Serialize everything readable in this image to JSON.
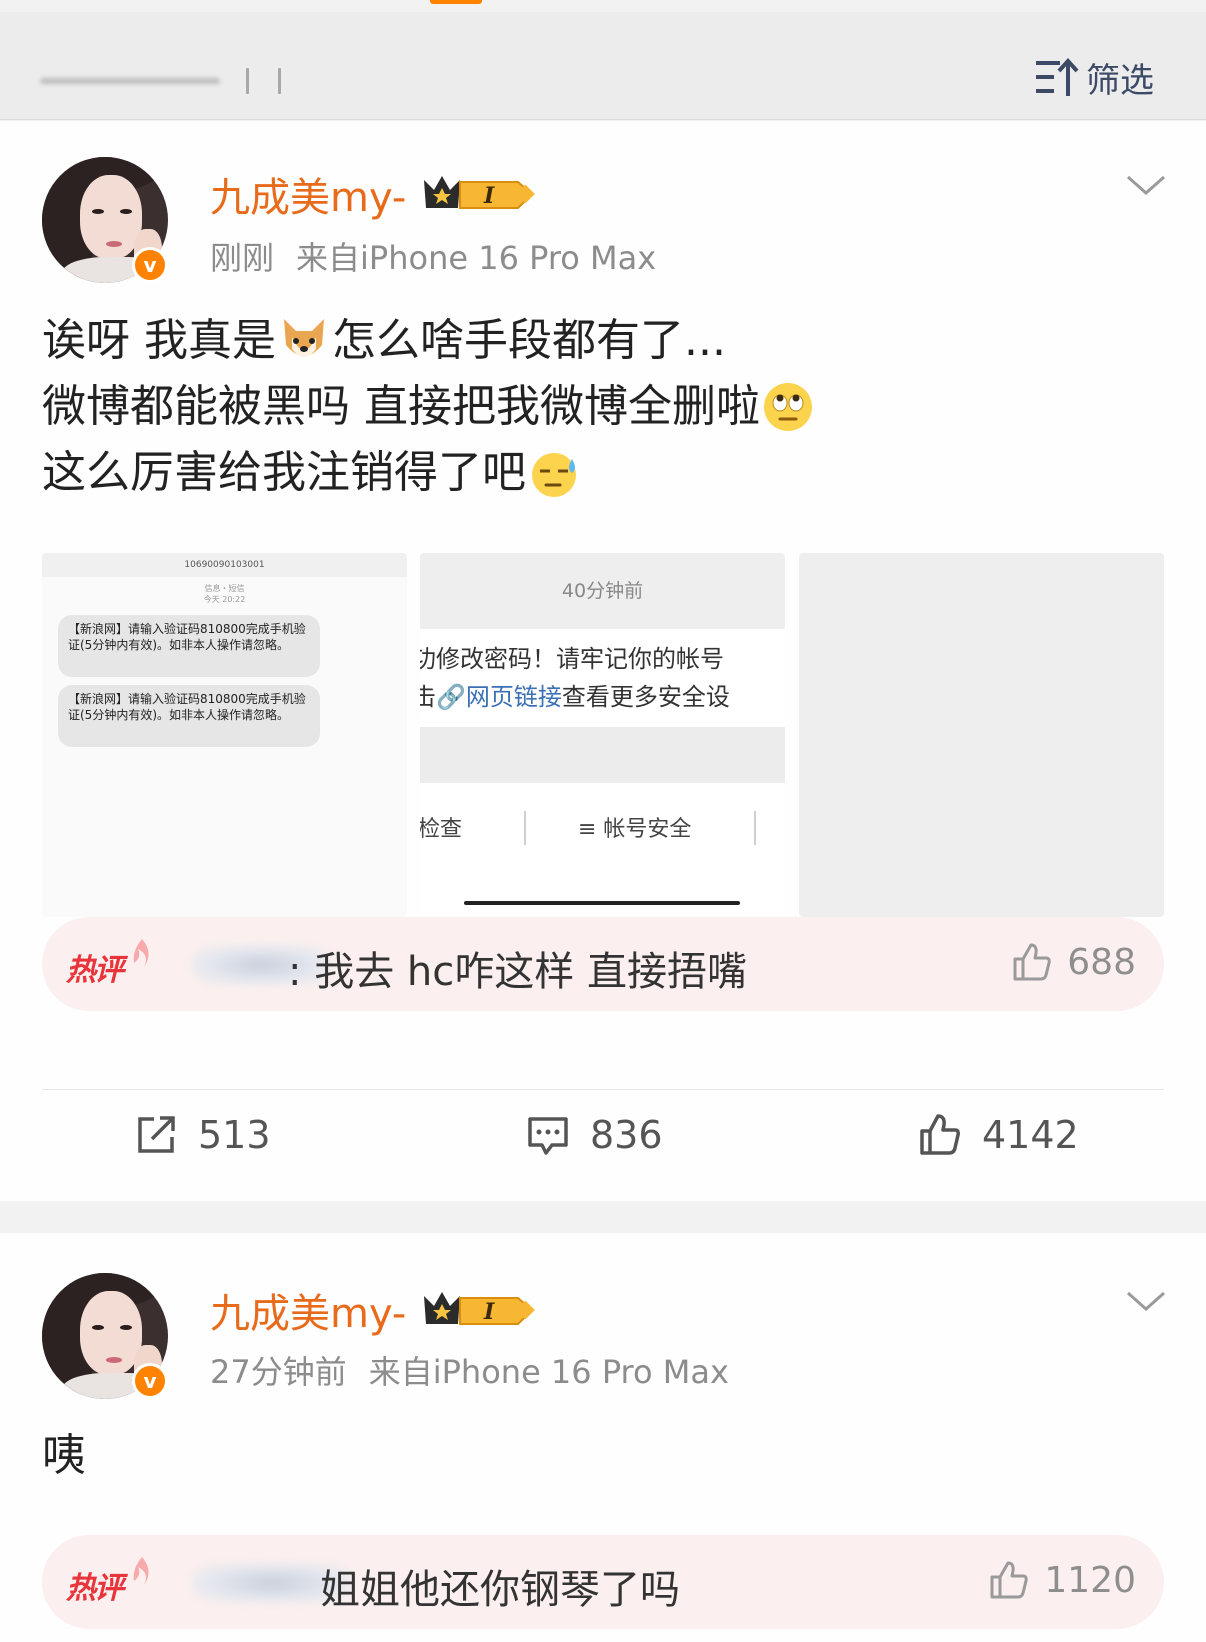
{
  "filter": {
    "label": "筛选",
    "icon": "filter-sort-icon"
  },
  "posts": [
    {
      "username": "九成美my-",
      "time": "刚刚",
      "source": "来自iPhone 16 Pro Max",
      "text_lines": [
        [
          "诶呀 我真是",
          "怎么啥手段都有了..."
        ],
        [
          "微博都能被黑吗 直接把我微博全删啦",
          ""
        ],
        [
          "这么厉害给我注销得了吧",
          ""
        ]
      ],
      "emojis": [
        "doge-icon",
        "eye-roll-emoji-icon",
        "sweat-emoji-icon"
      ],
      "images": {
        "sms": {
          "sender": "10690090103001",
          "sub1": "信息・短信",
          "sub2": "今天 20:22",
          "messages": [
            "【新浪网】请输入验证码810800完成手机验证(5分钟内有效)。如非本人操作请忽略。",
            "【新浪网】请输入验证码810800完成手机验证(5分钟内有效)。如非本人操作请忽略。"
          ]
        },
        "screenshot": {
          "time": "40分钟前",
          "line1": "功修改密码！请牢记你的帐号",
          "line2_prefix": "击",
          "line2_link": "网页链接",
          "line2_suffix": "查看更多安全设",
          "tab1": "检查",
          "tab2": "≡ 帐号安全"
        }
      },
      "hot_comment": {
        "tag": "热评",
        "text": ": 我去 hc咋这样 直接捂嘴",
        "likes": "688"
      },
      "actions": {
        "reposts": "513",
        "comments": "836",
        "likes": "4142"
      }
    },
    {
      "username": "九成美my-",
      "time": "27分钟前",
      "source": "来自iPhone 16 Pro Max",
      "text": "咦",
      "hot_comment": {
        "tag": "热评",
        "text": "姐姐他还你钢琴了吗",
        "likes": "1120"
      }
    }
  ],
  "colors": {
    "accent": "#ff8200",
    "username": "#e86b1b",
    "hot_tag": "#e8343a",
    "link": "#3b6fb6"
  }
}
